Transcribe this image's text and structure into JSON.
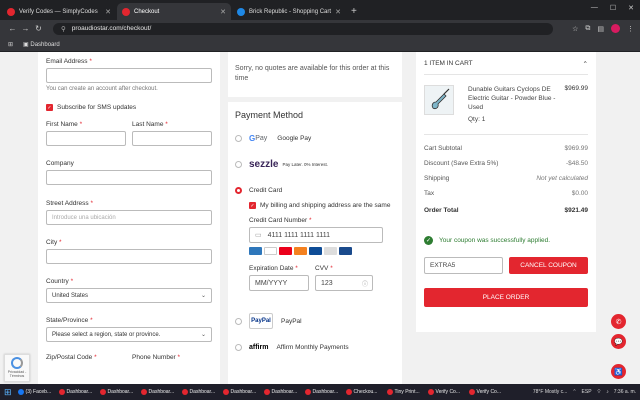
{
  "browser": {
    "tabs": [
      {
        "title": "Verify Codes — SimplyCodes",
        "color": "#e3262f",
        "active": false
      },
      {
        "title": "Checkout",
        "color": "#e3262f",
        "active": true
      },
      {
        "title": "Brick Republic - Shopping Cart",
        "color": "#1e88e5",
        "active": false
      }
    ],
    "url": "proaudiostar.com/checkout/",
    "bookmark": "Dashboard"
  },
  "form": {
    "email_label": "Email Address",
    "email_value": "",
    "email_hint": "You can create an account after checkout.",
    "sms_label": "Subscribe for SMS updates",
    "first_name_label": "First Name",
    "last_name_label": "Last Name",
    "company_label": "Company",
    "street_label": "Street Address",
    "street_placeholder": "Introduce una ubicación",
    "city_label": "City",
    "country_label": "Country",
    "country_value": "United States",
    "state_label": "State/Province",
    "state_value": "Please select a region, state or province.",
    "zip_label": "Zip/Postal Code",
    "phone_label": "Phone Number"
  },
  "shipping": {
    "quote_message": "Sorry, no quotes are available for this order at this time"
  },
  "payment": {
    "title": "Payment Method",
    "gpay_g": "G",
    "gpay_pay": "Pay",
    "gpay_label": "Google Pay",
    "sezzle_logo": "sezzle",
    "sezzle_note": "Pay Later. 0% Interest.",
    "credit_card_label": "Credit Card",
    "billing_same_label": "My billing and shipping address are the same",
    "cc_number_label": "Credit Card Number",
    "cc_number_placeholder": "4111 1111 1111 1111",
    "expiration_label": "Expiration Date",
    "expiration_placeholder": "MM/YYYY",
    "cvv_label": "CVV",
    "cvv_placeholder": "123",
    "paypal_logo": "PayPal",
    "paypal_label": "PayPal",
    "affirm_logo": "affirm",
    "affirm_label": "Affirm Monthly Payments"
  },
  "cart": {
    "heading": "1 Item in Cart",
    "item_name": "Dunable Guitars Cyclops DE Electric Guitar - Powder Blue - Used",
    "item_qty": "Qty:  1",
    "item_price": "$969.99",
    "subtotal_label": "Cart Subtotal",
    "subtotal_value": "$969.99",
    "discount_label": "Discount (Save Extra 5%)",
    "discount_value": "-$48.50",
    "shipping_label": "Shipping",
    "shipping_value": "Not yet calculated",
    "tax_label": "Tax",
    "tax_value": "$0.00",
    "total_label": "Order Total",
    "total_value": "$921.49",
    "coupon_success": "Your coupon was successfully applied.",
    "coupon_code": "EXTRA5",
    "cancel_coupon_label": "Cancel Coupon",
    "place_order_label": "Place Order"
  },
  "recaptcha": {
    "text": "Privacidad - Términos"
  },
  "taskbar": {
    "items": [
      {
        "label": "(3) Faceb...",
        "color": "#1877f2"
      },
      {
        "label": "Dashboar...",
        "color": "#e3262f"
      },
      {
        "label": "Dashboar...",
        "color": "#e3262f"
      },
      {
        "label": "Dashboar...",
        "color": "#e3262f"
      },
      {
        "label": "Dashboar...",
        "color": "#e3262f"
      },
      {
        "label": "Dashboar...",
        "color": "#e3262f"
      },
      {
        "label": "Dashboar...",
        "color": "#e3262f"
      },
      {
        "label": "Dashboar...",
        "color": "#e3262f"
      },
      {
        "label": "Checkou...",
        "color": "#e3262f"
      },
      {
        "label": "Tiny Print...",
        "color": "#e3262f"
      },
      {
        "label": "Verify Co...",
        "color": "#e3262f"
      },
      {
        "label": "Verify Co...",
        "color": "#e3262f"
      }
    ],
    "weather": "78°F Mostly c...",
    "lang": "ESP",
    "time": "7:36 a. m."
  }
}
